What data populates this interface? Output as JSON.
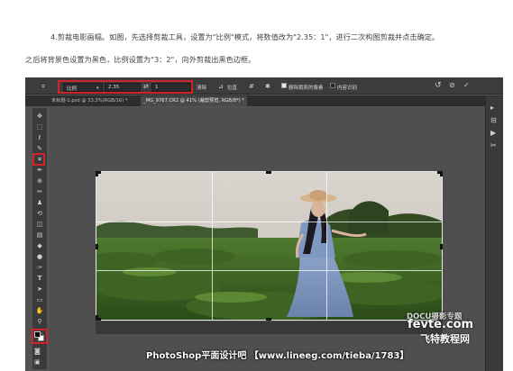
{
  "article": {
    "paragraph1": "4.剪裁电影画幅。如图，先选择剪裁工具，设置为\"比例\"模式，将数值改为\"2.35：1\"，进行二次构图剪裁并点击确定。",
    "paragraph2": "之后将背景色设置为黑色，比例设置为\"3：2\"，向外剪裁出黑色边框。"
  },
  "photoshop": {
    "options_bar": {
      "mode": "比例",
      "ratio_width": "2.35",
      "swap_symbol": "⇄",
      "ratio_height": "1",
      "clear_button": "清除",
      "straighten_label": "拉直",
      "delete_pixels_label": "删除裁剪的像素",
      "delete_pixels_checked": true,
      "content_aware_label": "内容识别",
      "content_aware_checked": false
    },
    "tabs": [
      {
        "label": "未标题-1.psd @ 33.3%(RGB/16) *",
        "active": false
      },
      {
        "label": "_MG_9767.CR2 @ 41% (裁剪预览, RGB/8*) *",
        "active": true
      }
    ],
    "colors": {
      "foreground": "#000000",
      "background": "#ffffff",
      "highlight": "#d2232a"
    }
  },
  "watermarks": {
    "docu": "DOCU摄影专题",
    "fevte": "fevte.com",
    "fevte_cn": "飞特教程网",
    "footer": "PhotoShop平面设计吧 【www.lineeg.com/tieba/1783】"
  }
}
